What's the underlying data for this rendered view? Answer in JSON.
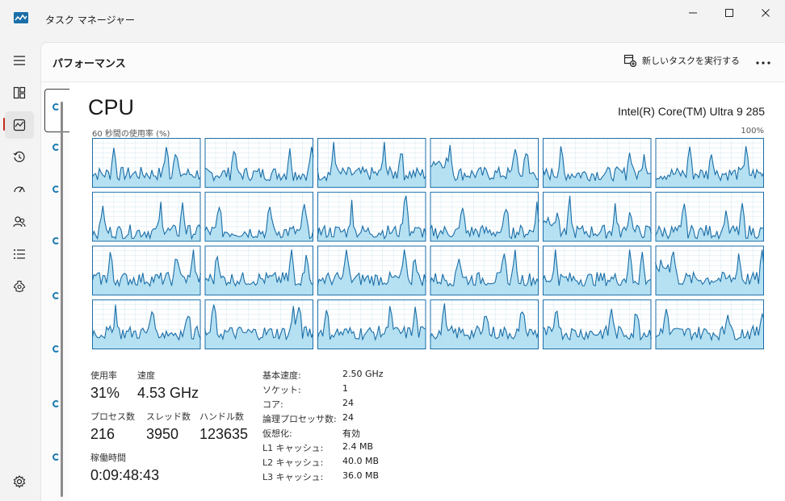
{
  "window": {
    "title": "タスク マネージャー"
  },
  "header": {
    "page_title": "パフォーマンス",
    "new_task_label": "新しいタスクを実行する"
  },
  "cpu": {
    "title": "CPU",
    "model": "Intel(R) Core(TM) Ultra 9 285",
    "graph_caption": "60 秒間の使用率 (%)",
    "graph_max": "100%",
    "graph_rows": 4,
    "graph_cols": 6,
    "utilization_label": "使用率",
    "utilization_value": "31%",
    "speed_label": "速度",
    "speed_value": "4.53 GHz",
    "processes_label": "プロセス数",
    "processes_value": "216",
    "threads_label": "スレッド数",
    "threads_value": "3950",
    "handles_label": "ハンドル数",
    "handles_value": "123635",
    "uptime_label": "稼働時間",
    "uptime_value": "0:09:48:43",
    "specs": [
      {
        "label": "基本速度:",
        "value": "2.50 GHz"
      },
      {
        "label": "ソケット:",
        "value": "1"
      },
      {
        "label": "コア:",
        "value": "24"
      },
      {
        "label": "論理プロセッサ数:",
        "value": "24"
      },
      {
        "label": "仮想化:",
        "value": "有効"
      },
      {
        "label": "L1 キャッシュ:",
        "value": "2.4 MB"
      },
      {
        "label": "L2 キャッシュ:",
        "value": "40.0 MB"
      },
      {
        "label": "L3 キャッシュ:",
        "value": "36.0 MB"
      }
    ]
  },
  "nav": {
    "items": [
      {
        "icon": "hamburger-menu-icon"
      },
      {
        "icon": "processes-icon"
      },
      {
        "icon": "performance-icon",
        "active": true
      },
      {
        "icon": "app-history-icon"
      },
      {
        "icon": "startup-apps-icon"
      },
      {
        "icon": "users-icon"
      },
      {
        "icon": "details-icon"
      },
      {
        "icon": "services-icon"
      }
    ],
    "settings_icon": "settings-icon"
  },
  "colors": {
    "graph_line": "#1b6ea8",
    "graph_fill": "#a9dcf0",
    "graph_border": "#1b6ea8",
    "graph_grid": "#d9eaf3",
    "active_indicator": "#c42b1c"
  }
}
